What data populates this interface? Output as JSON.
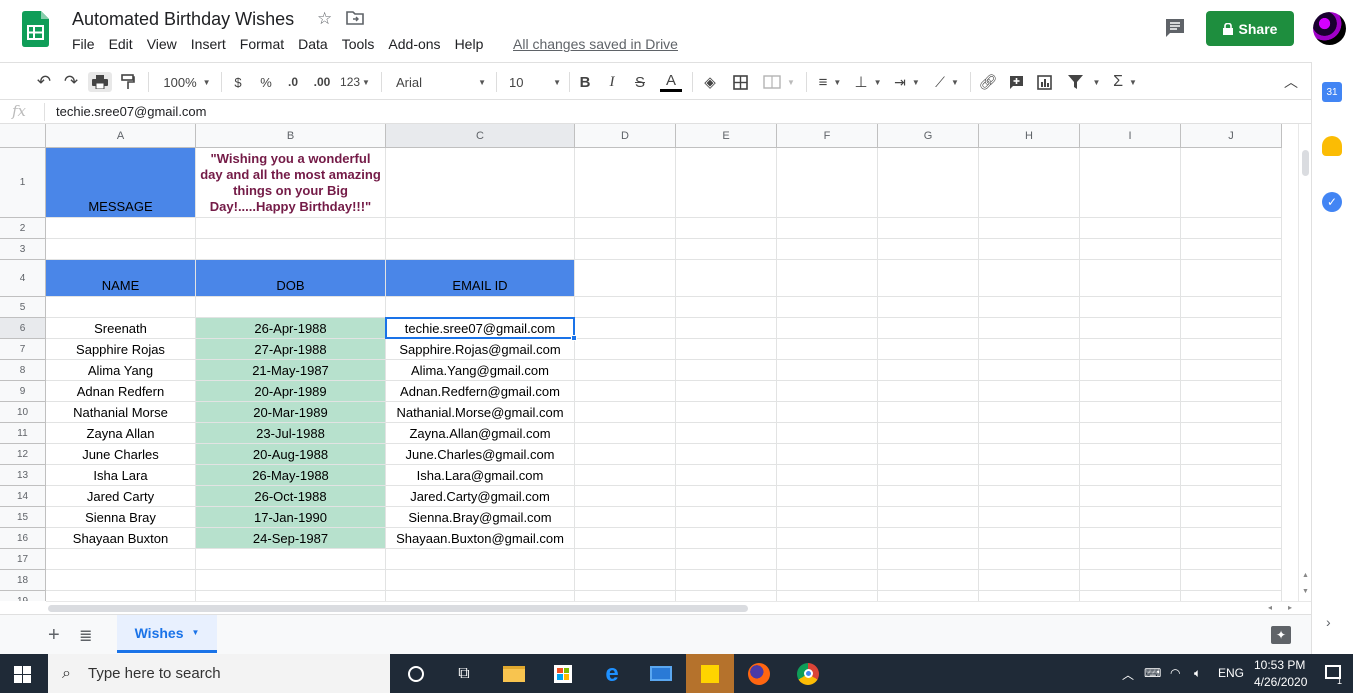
{
  "doc": {
    "title": "Automated Birthday Wishes",
    "save_status": "All changes saved in Drive",
    "share_label": "Share"
  },
  "menu": [
    "File",
    "Edit",
    "View",
    "Insert",
    "Format",
    "Data",
    "Tools",
    "Add-ons",
    "Help"
  ],
  "toolbar": {
    "zoom": "100%",
    "currency": "$",
    "percent": "%",
    "decimal_decrease": ".0",
    "decimal_increase": ".00",
    "more_formats": "123",
    "font": "Arial",
    "font_size": "10",
    "bold": "B",
    "italic": "I",
    "strike": "S",
    "text_color": "A"
  },
  "formula_bar": {
    "value": "techie.sree07@gmail.com"
  },
  "columns": [
    "A",
    "B",
    "C",
    "D",
    "E",
    "F",
    "G",
    "H",
    "I",
    "J"
  ],
  "rows": [
    "1",
    "2",
    "3",
    "4",
    "5",
    "6",
    "7",
    "8",
    "9",
    "10",
    "11",
    "12",
    "13",
    "14",
    "15",
    "16",
    "17",
    "18",
    "19"
  ],
  "sheet": {
    "message_label": "MESSAGE",
    "message_text": "\"Wishing you a wonderful day and all the most amazing things on your Big Day!.....Happy Birthday!!!\"",
    "headers": {
      "name": "NAME",
      "dob": "DOB",
      "email": "EMAIL ID"
    },
    "records": [
      {
        "name": "Sreenath",
        "dob": "26-Apr-1988",
        "email": "techie.sree07@gmail.com"
      },
      {
        "name": "Sapphire Rojas",
        "dob": "27-Apr-1988",
        "email": "Sapphire.Rojas@gmail.com"
      },
      {
        "name": "Alima Yang",
        "dob": "21-May-1987",
        "email": "Alima.Yang@gmail.com"
      },
      {
        "name": "Adnan Redfern",
        "dob": "20-Apr-1989",
        "email": "Adnan.Redfern@gmail.com"
      },
      {
        "name": "Nathanial Morse",
        "dob": "20-Mar-1989",
        "email": "Nathanial.Morse@gmail.com"
      },
      {
        "name": "Zayna Allan",
        "dob": "23-Jul-1988",
        "email": "Zayna.Allan@gmail.com"
      },
      {
        "name": "June Charles",
        "dob": "20-Aug-1988",
        "email": "June.Charles@gmail.com"
      },
      {
        "name": "Isha Lara",
        "dob": "26-May-1988",
        "email": "Isha.Lara@gmail.com"
      },
      {
        "name": "Jared Carty",
        "dob": "26-Oct-1988",
        "email": "Jared.Carty@gmail.com"
      },
      {
        "name": "Sienna Bray",
        "dob": "17-Jan-1990",
        "email": "Sienna.Bray@gmail.com"
      },
      {
        "name": "Shayaan Buxton",
        "dob": "24-Sep-1987",
        "email": "Shayaan.Buxton@gmail.com"
      }
    ]
  },
  "tabs": {
    "active": "Wishes"
  },
  "taskbar": {
    "search_placeholder": "Type here to search",
    "language": "ENG",
    "time": "10:53 PM",
    "date": "4/26/2020",
    "notification_count": "1"
  },
  "colors": {
    "header_blue": "#4a86e8",
    "dob_green": "#b7e1cd",
    "message_text": "#741b47",
    "share_green": "#1e8e3e",
    "selection_blue": "#1a73e8"
  }
}
